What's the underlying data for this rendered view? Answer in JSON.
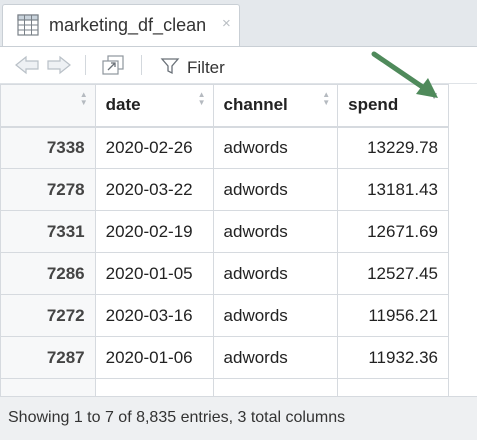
{
  "tab": {
    "title": "marketing_df_clean",
    "close_glyph": "×",
    "icon": "table-icon"
  },
  "toolbar": {
    "back_icon": "arrow-left-icon",
    "forward_icon": "arrow-right-icon",
    "popout_icon": "popout-icon",
    "filter_icon": "funnel-icon",
    "filter_label": "Filter"
  },
  "table": {
    "columns": [
      "",
      "date",
      "channel",
      "spend"
    ],
    "sorted_column": "spend",
    "sort_direction": "descending",
    "rows": [
      {
        "row": "7338",
        "date": "2020-02-26",
        "channel": "adwords",
        "spend": "13229.78"
      },
      {
        "row": "7278",
        "date": "2020-03-22",
        "channel": "adwords",
        "spend": "13181.43"
      },
      {
        "row": "7331",
        "date": "2020-02-19",
        "channel": "adwords",
        "spend": "12671.69"
      },
      {
        "row": "7286",
        "date": "2020-01-05",
        "channel": "adwords",
        "spend": "12527.45"
      },
      {
        "row": "7272",
        "date": "2020-03-16",
        "channel": "adwords",
        "spend": "11956.21"
      },
      {
        "row": "7287",
        "date": "2020-01-06",
        "channel": "adwords",
        "spend": "11932.36"
      },
      {
        "row": "",
        "date": "",
        "channel": "",
        "spend": ""
      }
    ]
  },
  "status": {
    "text": "Showing 1 to 7 of 8,835 entries, 3 total columns"
  },
  "colors": {
    "annotation_arrow": "#4f8a5b",
    "tabbar_bg": "#e4e8ec",
    "status_bg": "#eef0f2"
  }
}
